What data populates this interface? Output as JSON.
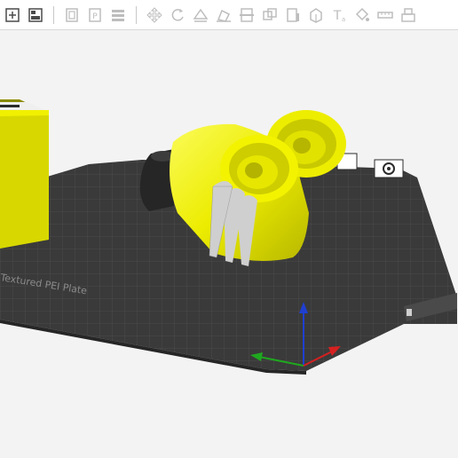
{
  "toolbar": {
    "buttons": [
      {
        "name": "add-object-button",
        "icon": "cube-plus-icon"
      },
      {
        "name": "arrange-button",
        "icon": "arrange-icon"
      },
      {
        "name": "orient-button",
        "icon": "orient-icon"
      },
      {
        "name": "plate-button",
        "icon": "plate-icon"
      },
      {
        "name": "layers-button",
        "icon": "layers-icon"
      },
      {
        "name": "move-tool-button",
        "icon": "move-icon"
      },
      {
        "name": "rotate-tool-button",
        "icon": "rotate-icon"
      },
      {
        "name": "auto-orient-button",
        "icon": "auto-orient-icon"
      },
      {
        "name": "lay-on-face-button",
        "icon": "lay-on-face-icon"
      },
      {
        "name": "cut-tool-button",
        "icon": "cut-icon"
      },
      {
        "name": "boolean-tool-button",
        "icon": "boolean-icon"
      },
      {
        "name": "support-paint-button",
        "icon": "support-paint-icon"
      },
      {
        "name": "seam-paint-button",
        "icon": "seam-icon"
      },
      {
        "name": "text-tool-button",
        "icon": "text-icon"
      },
      {
        "name": "color-paint-button",
        "icon": "paint-bucket-icon"
      },
      {
        "name": "measure-tool-button",
        "icon": "ruler-icon"
      },
      {
        "name": "assembly-button",
        "icon": "assembly-icon"
      }
    ],
    "accent": "#4a4a4a"
  },
  "viewport": {
    "plate_label": "Textured PEI Plate",
    "colors": {
      "model_yellow": "#f0f000",
      "model_stripe": "#c8c8c8",
      "model_dark": "#2b2b2b",
      "plate": "#3a3a3a",
      "grid": "#5a5a5a",
      "axis_x": "#d62020",
      "axis_y": "#1fa81f",
      "axis_z": "#1f3fd0"
    }
  }
}
